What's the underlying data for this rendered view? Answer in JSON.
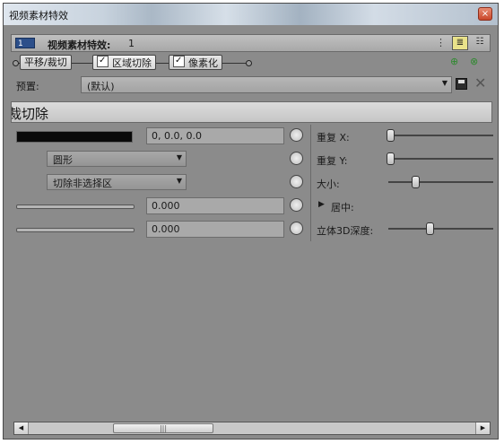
{
  "window": {
    "title": "视频素材特效",
    "close_glyph": "×"
  },
  "header": {
    "fx_badge": "1",
    "label": "视频素材特效:",
    "count": "1",
    "dots": "⋮",
    "list_view_glyph": "≣",
    "grid_view_glyph": "☷"
  },
  "chain": {
    "items": [
      {
        "label": "平移/裁切",
        "checked": false
      },
      {
        "label": "区域切除",
        "checked": true
      },
      {
        "label": "像素化",
        "checked": true
      }
    ],
    "add_plugin_glyph": "⊕",
    "remove_plugin_glyph": "⊗"
  },
  "preset": {
    "label": "预置:",
    "value": "(默认)",
    "arrow": "▼",
    "delete_glyph": "✕"
  },
  "section": {
    "title": "裁切除"
  },
  "params": {
    "row1": {
      "value": "0, 0.0, 0.0",
      "right_label": "重复 X:"
    },
    "row2": {
      "dropdown": "圆形",
      "right_label": "重复 Y:"
    },
    "row3": {
      "dropdown": "切除非选择区",
      "right_label": "大小:"
    },
    "row4": {
      "value": "0.000",
      "right_label": "居中:"
    },
    "row5": {
      "value": "0.000",
      "right_label": "立体3D深度:"
    },
    "dropdown_arrow": "▼",
    "expand_glyph": "▶",
    "clock_glyph": "🕓"
  },
  "scrollbar": {
    "left": "◀",
    "right": "▶",
    "grip": "|||"
  },
  "colors": {
    "panel": "#8b8b8b",
    "accent": "#2c4f8a"
  }
}
